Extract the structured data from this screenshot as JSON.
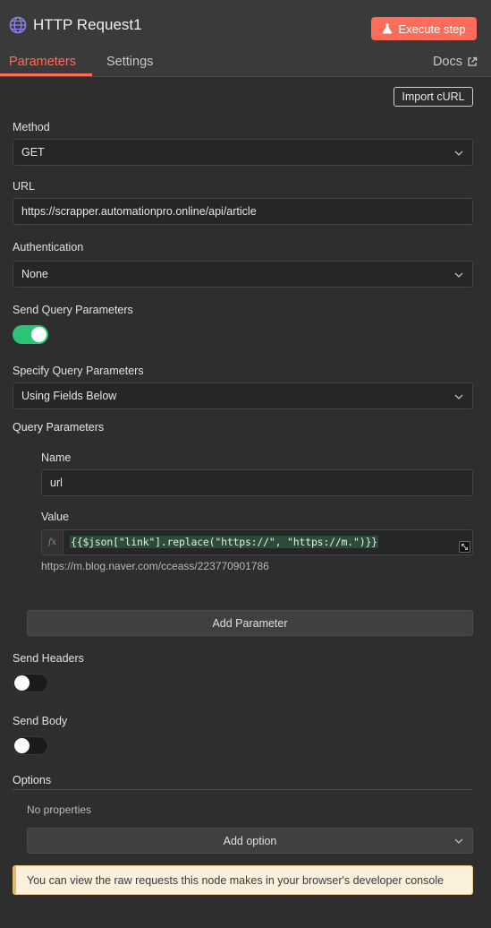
{
  "header": {
    "title": "HTTP Request1",
    "execute_label": "Execute step",
    "tabs": {
      "parameters": "Parameters",
      "settings": "Settings"
    },
    "docs_label": "Docs",
    "accent_color": "#ff6d5a"
  },
  "import_curl_label": "Import cURL",
  "method": {
    "label": "Method",
    "value": "GET"
  },
  "url": {
    "label": "URL",
    "value": "https://scrapper.automationpro.online/api/article"
  },
  "authentication": {
    "label": "Authentication",
    "value": "None"
  },
  "send_query": {
    "label": "Send Query Parameters",
    "enabled": true
  },
  "specify_query": {
    "label": "Specify Query Parameters",
    "value": "Using Fields Below"
  },
  "query_parameters": {
    "heading": "Query Parameters",
    "name_label": "Name",
    "name_value": "url",
    "value_label": "Value",
    "fx_label": "fx",
    "value_expression": "{{$json[\"link\"].replace(\"https://\", \"https://m.\")}}",
    "value_result": "https://m.blog.naver.com/cceass/223770901786",
    "add_label": "Add Parameter"
  },
  "send_headers": {
    "label": "Send Headers",
    "enabled": false
  },
  "send_body": {
    "label": "Send Body",
    "enabled": false
  },
  "options": {
    "heading": "Options",
    "empty_text": "No properties",
    "add_label": "Add option"
  },
  "notice": "You can view the raw requests this node makes in your browser's developer console"
}
